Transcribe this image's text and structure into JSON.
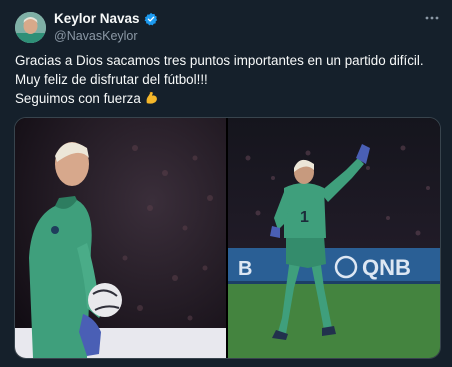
{
  "tweet": {
    "author": {
      "name": "Keylor Navas",
      "handle": "@NavasKeylor",
      "verified": true
    },
    "text_lines": [
      "Gracias a Dios sacamos tres puntos importantes en un partido difícil.",
      "Muy feliz de disfrutar del fútbol!!!",
      "Seguimos con fuerza"
    ],
    "emoji": "flexed-biceps",
    "media": [
      {
        "content": "goalkeeper-holding-ball",
        "jersey_number": ""
      },
      {
        "content": "goalkeeper-raising-arm",
        "jersey_number": "1",
        "board_text": "QNB"
      }
    ]
  },
  "colors": {
    "background": "#15202b",
    "text": "#f7f9f9",
    "secondary_text": "#8b98a5",
    "verified_blue": "#1d9bf0",
    "kit_green": "#3fa27f",
    "board_blue": "#2a5f95"
  },
  "icons": [
    "verified-badge-icon",
    "more-options-icon",
    "flexed-biceps-emoji"
  ]
}
